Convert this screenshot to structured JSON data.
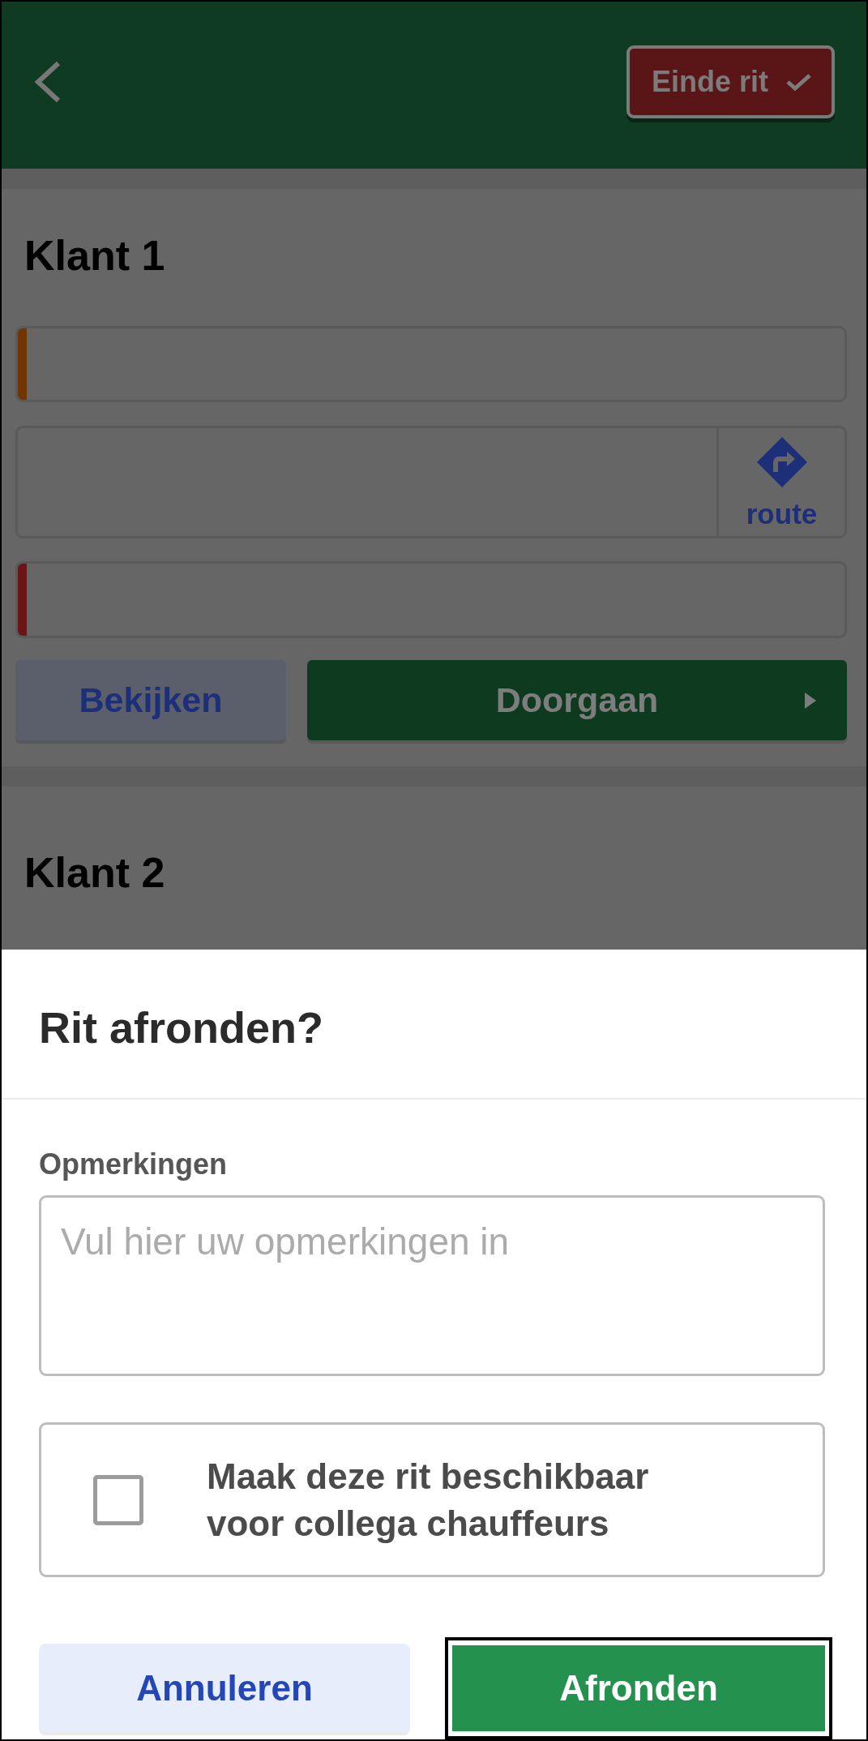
{
  "header": {
    "end_button": {
      "label": "Einde rit"
    }
  },
  "customers": [
    {
      "title": "Klant 1",
      "rows": [
        {
          "kind": "bar",
          "color": "#713500"
        },
        {
          "kind": "route",
          "label": "route"
        },
        {
          "kind": "bar",
          "color": "#6b1616"
        }
      ],
      "buttons": [
        {
          "label": "Bekijken",
          "kind": "secondary"
        },
        {
          "label": "Doorgaan",
          "kind": "primary"
        }
      ]
    },
    {
      "title": "Klant 2"
    }
  ],
  "dialog": {
    "title": "Rit afronden?",
    "remarks": {
      "label": "Opmerkingen",
      "placeholder": "Vul hier uw opmerkingen in"
    },
    "share_option": {
      "label": "Maak deze rit beschikbaar voor collega chauffeurs",
      "checked": false
    },
    "buttons": [
      {
        "label": "Annuleren",
        "kind": "secondary",
        "focused": false
      },
      {
        "label": "Afronden",
        "kind": "primary",
        "focused": true
      }
    ]
  }
}
